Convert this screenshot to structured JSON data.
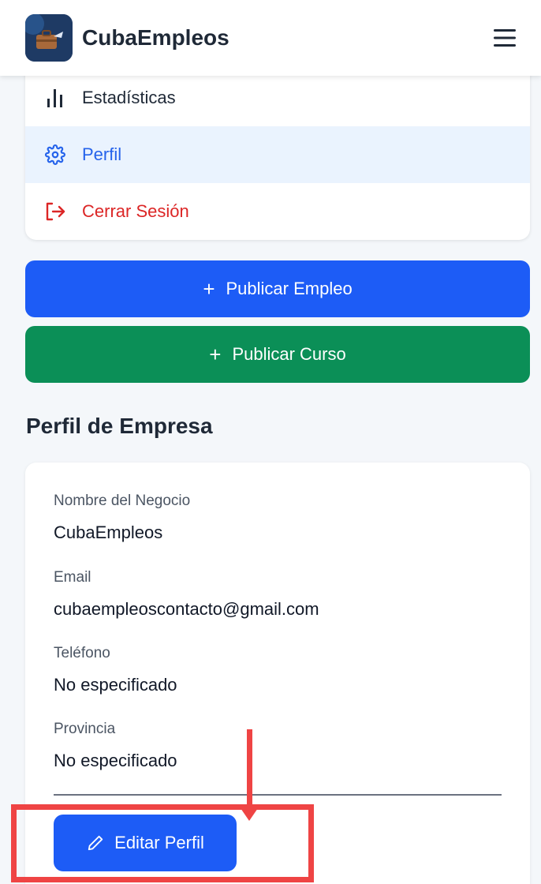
{
  "app": {
    "title": "CubaEmpleos"
  },
  "icons": {
    "logo": "briefcase-logo-icon",
    "menu": "hamburger-menu-icon",
    "stats": "bar-chart-icon",
    "settings": "gear-icon",
    "logout": "logout-icon",
    "plus": "plus-icon",
    "edit": "pencil-icon"
  },
  "nav": {
    "items": [
      {
        "label": "Estadísticas"
      },
      {
        "label": "Perfil",
        "active": true
      },
      {
        "label": "Cerrar Sesión"
      }
    ]
  },
  "actions": {
    "plus_symbol": "+",
    "publish_job": "Publicar Empleo",
    "publish_course": "Publicar Curso"
  },
  "profile": {
    "section_title": "Perfil de Empresa",
    "fields": [
      {
        "label": "Nombre del Negocio",
        "value": "CubaEmpleos"
      },
      {
        "label": "Email",
        "value": "cubaempleoscontacto@gmail.com"
      },
      {
        "label": "Teléfono",
        "value": "No especificado"
      },
      {
        "label": "Provincia",
        "value": "No especificado"
      }
    ],
    "edit_label": "Editar Perfil"
  },
  "colors": {
    "primary": "#1d5cf6",
    "success": "#0b8f57",
    "danger": "#dc2626",
    "active_bg": "#eaf3fe",
    "annotation": "#ef4444"
  }
}
